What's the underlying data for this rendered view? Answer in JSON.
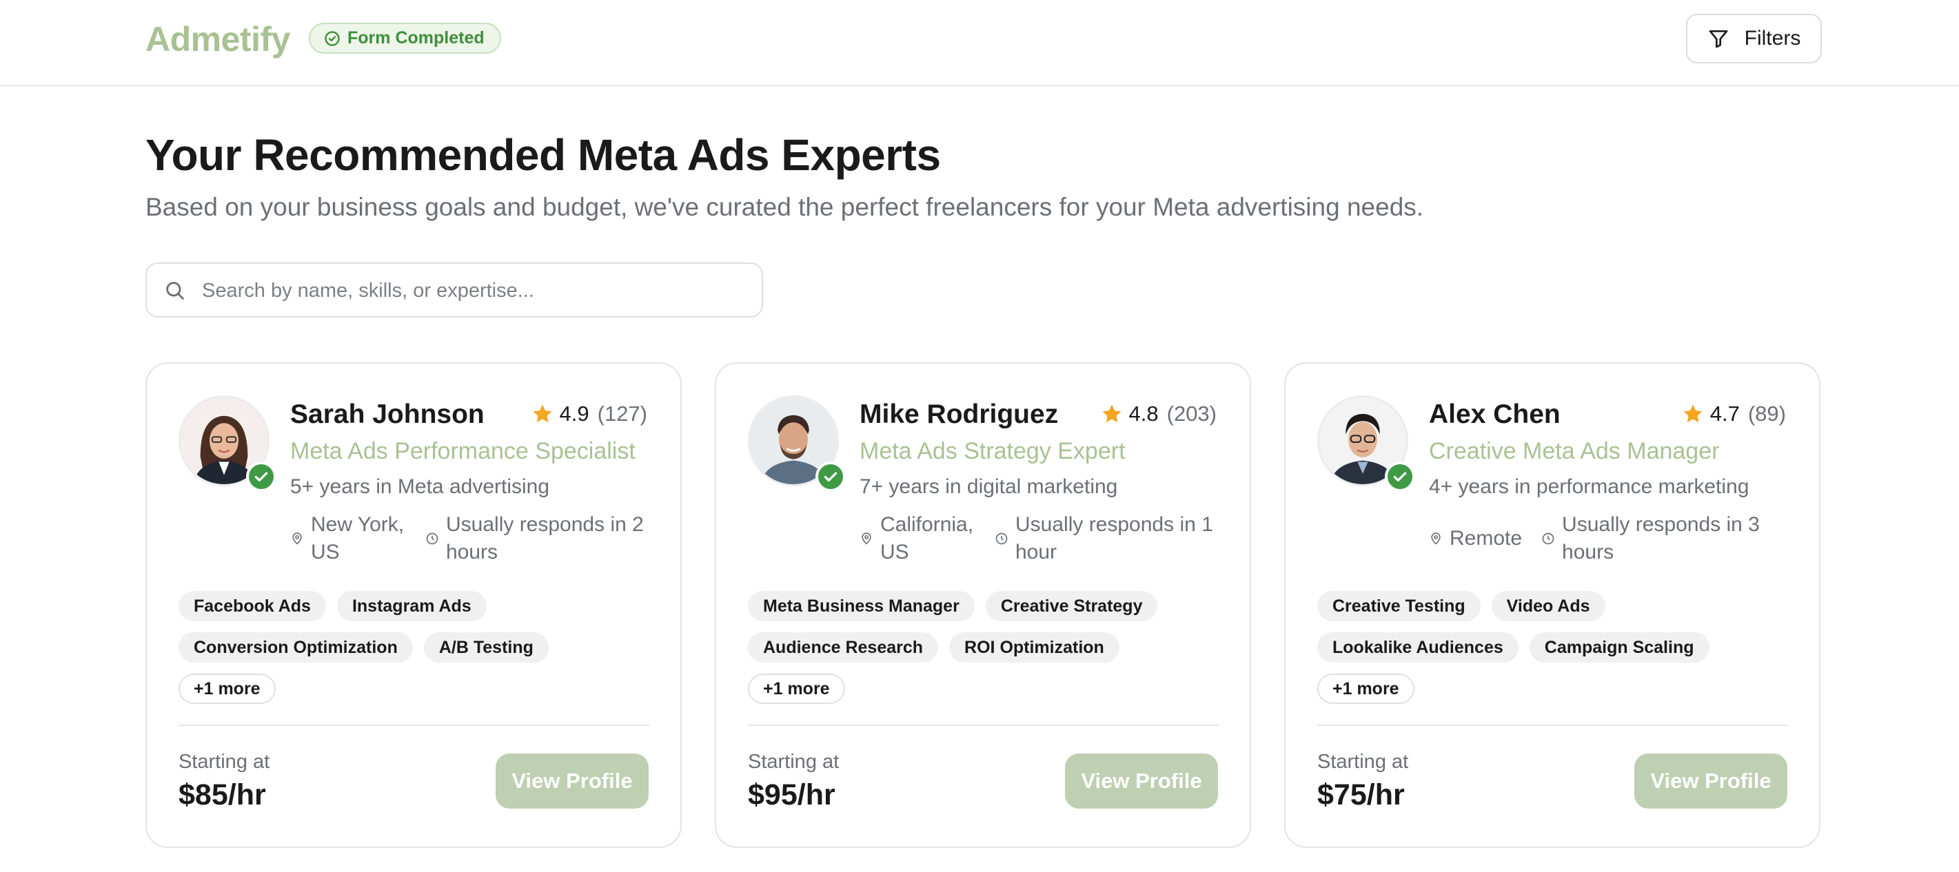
{
  "header": {
    "logo": "Admetify",
    "badge": "Form Completed",
    "filters_label": "Filters"
  },
  "page": {
    "title": "Your Recommended Meta Ads Experts",
    "subtitle": "Based on your business goals and budget, we've curated the perfect freelancers for your Meta advertising needs."
  },
  "search": {
    "placeholder": "Search by name, skills, or expertise...",
    "value": ""
  },
  "colors": {
    "brand": "#a9c193",
    "button": "#bfcfb1",
    "verified": "#3f9a45",
    "star": "#f5a623"
  },
  "experts": [
    {
      "name": "Sarah Johnson",
      "rating": "4.9",
      "reviews": "(127)",
      "role": "Meta Ads Performance Specialist",
      "experience": "5+ years in Meta advertising",
      "location": "New York, US",
      "response": "Usually responds in 2 hours",
      "tags": [
        "Facebook Ads",
        "Instagram Ads",
        "Conversion Optimization",
        "A/B Testing"
      ],
      "more": "+1 more",
      "price_label": "Starting at",
      "price": "$85/hr",
      "button": "View Profile"
    },
    {
      "name": "Mike Rodriguez",
      "rating": "4.8",
      "reviews": "(203)",
      "role": "Meta Ads Strategy Expert",
      "experience": "7+ years in digital marketing",
      "location": "California, US",
      "response": "Usually responds in 1 hour",
      "tags": [
        "Meta Business Manager",
        "Creative Strategy",
        "Audience Research",
        "ROI Optimization"
      ],
      "more": "+1 more",
      "price_label": "Starting at",
      "price": "$95/hr",
      "button": "View Profile"
    },
    {
      "name": "Alex Chen",
      "rating": "4.7",
      "reviews": "(89)",
      "role": "Creative Meta Ads Manager",
      "experience": "4+ years in performance marketing",
      "location": "Remote",
      "response": "Usually responds in 3 hours",
      "tags": [
        "Creative Testing",
        "Video Ads",
        "Lookalike Audiences",
        "Campaign Scaling"
      ],
      "more": "+1 more",
      "price_label": "Starting at",
      "price": "$75/hr",
      "button": "View Profile"
    }
  ]
}
